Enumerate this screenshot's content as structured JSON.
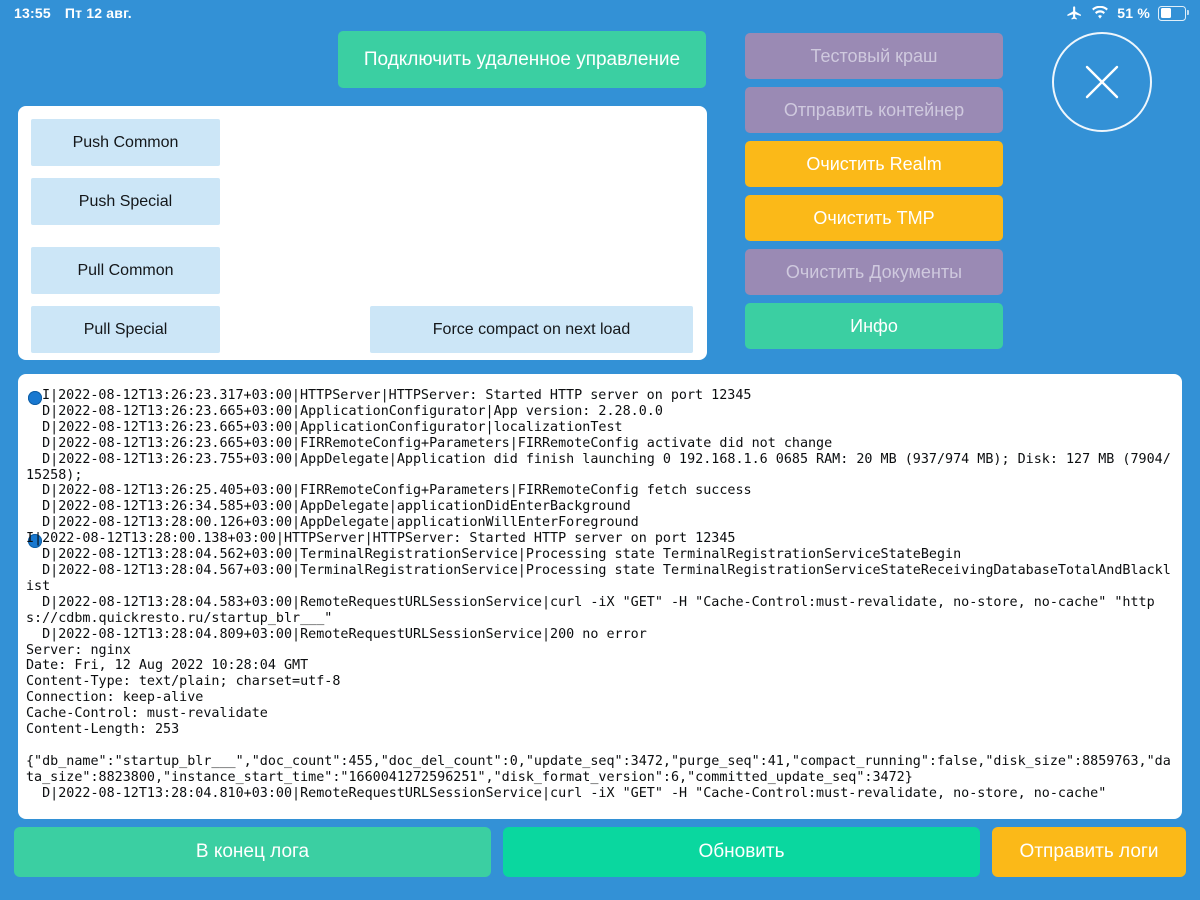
{
  "status_bar": {
    "time": "13:55",
    "date": "Пт 12 авг.",
    "airplane_icon": "airplane-icon",
    "wifi_icon": "wifi-icon",
    "battery_percent": "51 %",
    "battery_level": 51
  },
  "header": {
    "remote_control_label": "Подключить удаленное управление",
    "close_label": "close-icon"
  },
  "right_buttons": [
    {
      "label": "Тестовый краш",
      "state": "disabled"
    },
    {
      "label": "Отправить контейнер",
      "state": "disabled"
    },
    {
      "label": "Очистить Realm",
      "state": "warn"
    },
    {
      "label": "Очистить TMP",
      "state": "warn"
    },
    {
      "label": "Очистить Документы",
      "state": "disabled"
    },
    {
      "label": "Инфо",
      "state": "ok"
    }
  ],
  "tools_card": {
    "push_common": "Push Common",
    "push_special": "Push Special",
    "pull_common": "Pull Common",
    "pull_special": "Pull Special",
    "force_compact": "Force compact on next load"
  },
  "log": {
    "text": "I|2022-08-12T13:26:23.317+03:00|HTTPServer|HTTPServer: Started HTTP server on port 12345\n  D|2022-08-12T13:26:23.665+03:00|ApplicationConfigurator|App version: 2.28.0.0\n  D|2022-08-12T13:26:23.665+03:00|ApplicationConfigurator|localizationTest\n  D|2022-08-12T13:26:23.665+03:00|FIRRemoteConfig+Parameters|FIRRemoteConfig activate did not change\n  D|2022-08-12T13:26:23.755+03:00|AppDelegate|Application did finish launching 0 192.168.1.6 0685 RAM: 20 MB (937/974 MB); Disk: 127 MB (7904/15258);\n  D|2022-08-12T13:26:25.405+03:00|FIRRemoteConfig+Parameters|FIRRemoteConfig fetch success\n  D|2022-08-12T13:26:34.585+03:00|AppDelegate|applicationDidEnterBackground\n  D|2022-08-12T13:28:00.126+03:00|AppDelegate|applicationWillEnterForeground\nI|2022-08-12T13:28:00.138+03:00|HTTPServer|HTTPServer: Started HTTP server on port 12345\n  D|2022-08-12T13:28:04.562+03:00|TerminalRegistrationService|Processing state TerminalRegistrationServiceStateBegin\n  D|2022-08-12T13:28:04.567+03:00|TerminalRegistrationService|Processing state TerminalRegistrationServiceStateReceivingDatabaseTotalAndBlacklist\n  D|2022-08-12T13:28:04.583+03:00|RemoteRequestURLSessionService|curl -iX \"GET\" -H \"Cache-Control:must-revalidate, no-store, no-cache\" \"https://cdbm.quickresto.ru/startup_blr___\"\n  D|2022-08-12T13:28:04.809+03:00|RemoteRequestURLSessionService|200 no error\nServer: nginx\nDate: Fri, 12 Aug 2022 10:28:04 GMT\nContent-Type: text/plain; charset=utf-8\nConnection: keep-alive\nCache-Control: must-revalidate\nContent-Length: 253\n\n{\"db_name\":\"startup_blr___\",\"doc_count\":455,\"doc_del_count\":0,\"update_seq\":3472,\"purge_seq\":41,\"compact_running\":false,\"disk_size\":8859763,\"data_size\":8823800,\"instance_start_time\":\"1660041272596251\",\"disk_format_version\":6,\"committed_update_seq\":3472}\n  D|2022-08-12T13:28:04.810+03:00|RemoteRequestURLSessionService|curl -iX \"GET\" -H \"Cache-Control:must-revalidate, no-store, no-cache\"",
    "info_marker_icon": "info-dot-icon"
  },
  "bottom_buttons": {
    "log_end": "В конец лога",
    "refresh": "Обновить",
    "send_logs": "Отправить логи"
  },
  "colors": {
    "background": "#3391d6",
    "accent_green": "#3bcfa2",
    "accent_teal": "#0ad79f",
    "accent_orange": "#fbb918",
    "disabled_purple": "#9a8ab4",
    "light_blue_button": "#cce6f7",
    "panel_white": "#ffffff"
  }
}
